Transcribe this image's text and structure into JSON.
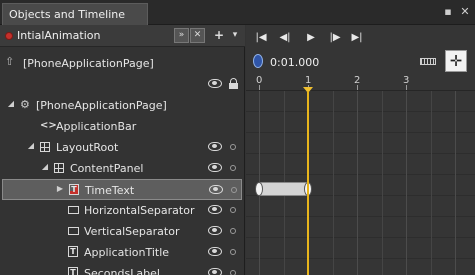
{
  "panel": {
    "tab_title": "Objects and Timeline",
    "pin_icon": "pin-icon",
    "close_icon": "close-icon"
  },
  "storyboard": {
    "name": "IntialAnimation",
    "collapse_label": "»",
    "close_label": "✕",
    "add_label": "+",
    "menu_label": "▾"
  },
  "scope": {
    "label": "[PhoneApplicationPage]"
  },
  "tree": {
    "items": [
      {
        "label": "[PhoneApplicationPage]",
        "icon": "page-icon",
        "expanded": true,
        "selected": false
      },
      {
        "label": "ApplicationBar",
        "icon": "code-brackets-icon",
        "expanded": false,
        "selected": false
      },
      {
        "label": "LayoutRoot",
        "icon": "grid-icon",
        "expanded": true,
        "selected": false
      },
      {
        "label": "ContentPanel",
        "icon": "grid-icon",
        "expanded": true,
        "selected": false
      },
      {
        "label": "TimeText",
        "icon": "textblock-record-icon",
        "expanded": false,
        "selected": true
      },
      {
        "label": "HorizontalSeparator",
        "icon": "rectangle-icon",
        "expanded": false,
        "selected": false
      },
      {
        "label": "VerticalSeparator",
        "icon": "rectangle-icon",
        "expanded": false,
        "selected": false
      },
      {
        "label": "ApplicationTitle",
        "icon": "textblock-icon",
        "expanded": false,
        "selected": false
      },
      {
        "label": "SecondsLabel",
        "icon": "textblock-icon",
        "expanded": false,
        "selected": false
      }
    ]
  },
  "timeline": {
    "current_time": "0:01.000",
    "ruler_labels": [
      "0",
      "1",
      "2",
      "3"
    ],
    "playhead_seconds": 1.0,
    "animation_start_seconds": 0.0,
    "animation_end_seconds": 1.0,
    "accent_color": "#e8b51c",
    "keyframe_color": "#f4f4f4"
  }
}
